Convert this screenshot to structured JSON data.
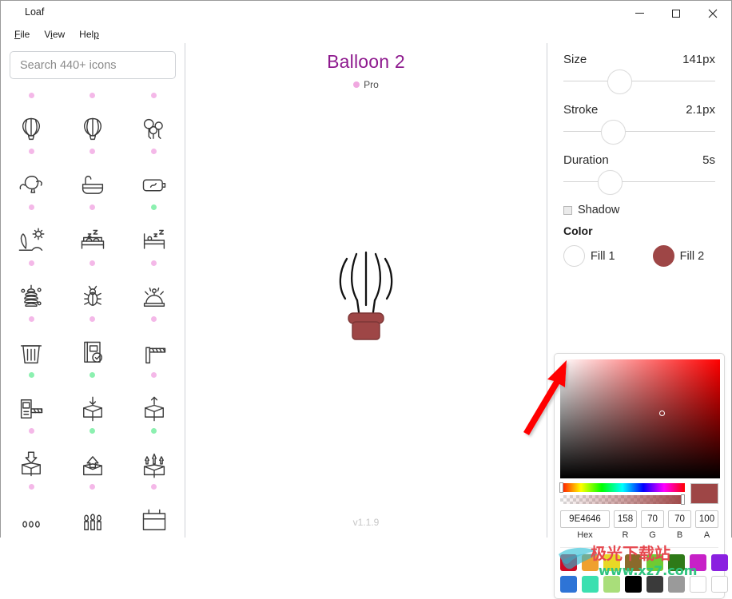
{
  "window": {
    "title": "Loaf",
    "controls": [
      {
        "name": "minimize-button",
        "label": "—"
      },
      {
        "name": "maximize-button",
        "label": "□"
      },
      {
        "name": "close-button",
        "label": "✕"
      }
    ]
  },
  "menubar": {
    "items": [
      {
        "label": "File",
        "accel": "F"
      },
      {
        "label": "View",
        "accel": "V"
      },
      {
        "label": "Help",
        "accel": "H"
      }
    ]
  },
  "sidebar": {
    "search": {
      "value": "",
      "placeholder": "Search 440+ icons"
    },
    "icons": [
      {
        "name": "cut-tree-icon",
        "status": "pink"
      },
      {
        "name": "bag-check-icon",
        "status": "pink"
      },
      {
        "name": "bag-download-icon",
        "status": "pink"
      },
      {
        "name": "hot-air-balloon-icon",
        "status": "pink"
      },
      {
        "name": "hot-air-balloon-2-icon",
        "status": "pink"
      },
      {
        "name": "party-balloons-icon",
        "status": "pink"
      },
      {
        "name": "balloon-clouds-icon",
        "status": "pink"
      },
      {
        "name": "bathtub-icon",
        "status": "pink"
      },
      {
        "name": "battery-charging-icon",
        "status": "green"
      },
      {
        "name": "beach-icon",
        "status": "pink"
      },
      {
        "name": "double-bed-sleep-icon",
        "status": "pink"
      },
      {
        "name": "person-sleeping-bed-icon",
        "status": "pink"
      },
      {
        "name": "beehive-icon",
        "status": "pink"
      },
      {
        "name": "beetle-bug-icon",
        "status": "pink"
      },
      {
        "name": "service-bell-icon",
        "status": "pink"
      },
      {
        "name": "trash-bin-icon",
        "status": "green"
      },
      {
        "name": "book-check-icon",
        "status": "green"
      },
      {
        "name": "boom-barrier-icon",
        "status": "pink"
      },
      {
        "name": "booth-barrier-icon",
        "status": "pink"
      },
      {
        "name": "box-arrow-in-icon",
        "status": "green"
      },
      {
        "name": "box-arrow-up-icon",
        "status": "green"
      },
      {
        "name": "box-arrow-down-thick-icon",
        "status": "pink"
      },
      {
        "name": "box-arrow-up-thick-icon",
        "status": "pink"
      },
      {
        "name": "box-arrows-multiple-icon",
        "status": "pink"
      },
      {
        "name": "candles-small-icon",
        "status": "pink"
      },
      {
        "name": "candles-icon",
        "status": "pink"
      },
      {
        "name": "calendar-icon",
        "status": "pink"
      }
    ]
  },
  "canvas": {
    "art_title": "Balloon 2",
    "pro_badge": "Pro",
    "version": "v1.1.9"
  },
  "properties": {
    "sliders": [
      {
        "name": "size",
        "label": "Size",
        "value": "141px",
        "percent": 34
      },
      {
        "name": "stroke",
        "label": "Stroke",
        "value": "2.1px",
        "percent": 29
      },
      {
        "name": "duration",
        "label": "Duration",
        "value": "5s",
        "percent": 27
      }
    ],
    "shadow": {
      "label": "Shadow",
      "checked": false
    },
    "color_section_title": "Color",
    "fills": [
      {
        "name": "fill-1",
        "label": "Fill 1",
        "color": "#FFFFFF"
      },
      {
        "name": "fill-2",
        "label": "Fill 2",
        "color": "#9E4646"
      }
    ]
  },
  "color_picker": {
    "current_color": "#9E4646",
    "hue_percent": 0,
    "alpha_percent": 100,
    "sat_cursor": {
      "x_percent": 62,
      "y_percent": 43
    },
    "fields": [
      {
        "name": "hex-field",
        "label": "Hex",
        "value": "9E4646"
      },
      {
        "name": "red-field",
        "label": "R",
        "value": "158"
      },
      {
        "name": "green-field",
        "label": "G",
        "value": "70"
      },
      {
        "name": "blue-field",
        "label": "B",
        "value": "70"
      },
      {
        "name": "alpha-field",
        "label": "A",
        "value": "100"
      }
    ],
    "swatches": [
      "#CE0A24",
      "#EFA02E",
      "#E8D826",
      "#8A6A2B",
      "#6FCB33",
      "#2E7A18",
      "#C721C7",
      "#8A20E0",
      "#2E74D6",
      "#3BE0B0",
      "#A9DE7A",
      "#000000",
      "#3A3A3A",
      "#9A9A9A",
      "#FFFFFF",
      "#FFFFFF"
    ]
  },
  "annotation": {
    "name": "red-arrow-pointing-to-fill-1",
    "color": "#FF0000"
  },
  "watermark": {
    "text": "www.xz7.com",
    "cn_text": "极光下载站"
  }
}
